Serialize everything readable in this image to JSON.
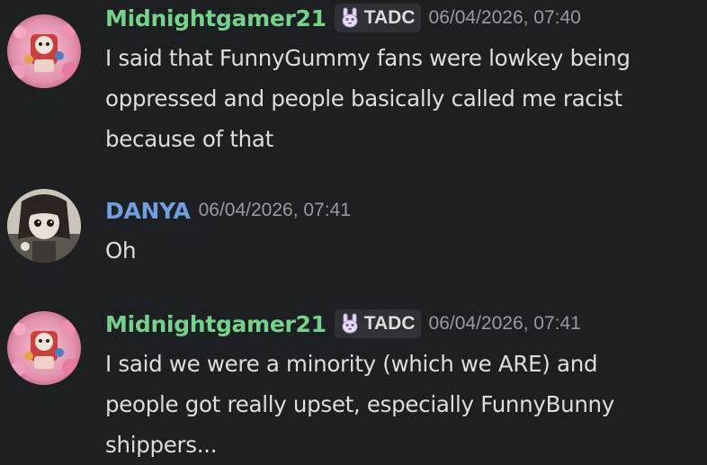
{
  "messages": [
    {
      "username": "Midnightgamer21",
      "username_color": "#75d28b",
      "tag": "TADC",
      "tag_icon": "bunny-icon",
      "timestamp": "06/04/2026, 07:40",
      "lines": [
        "I said that FunnyGummy fans were lowkey being",
        "oppressed and people basically called me racist",
        "because of that"
      ]
    },
    {
      "username": "DANYA",
      "username_color": "#6f9fdf",
      "timestamp": "06/04/2026, 07:41",
      "lines": [
        "Oh"
      ]
    },
    {
      "username": "Midnightgamer21",
      "username_color": "#75d28b",
      "tag": "TADC",
      "tag_icon": "bunny-icon",
      "timestamp": "06/04/2026, 07:41",
      "lines": [
        "I said we were a minority (which we ARE) and",
        "people got really upset, especially FunnyBunny",
        "shippers..."
      ]
    }
  ]
}
